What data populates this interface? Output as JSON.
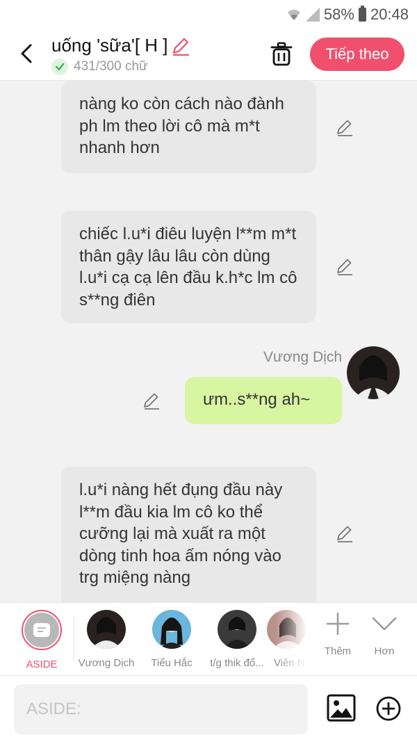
{
  "status": {
    "battery": "58%",
    "time": "20:48"
  },
  "header": {
    "title": "uống 'sữa'[ H ]",
    "word_count": "431/300 chữ",
    "next_label": "Tiếp theo"
  },
  "messages": [
    {
      "text": "nàng ko còn cách nào đành ph lm theo lời cô mà m*t nhanh hơn"
    },
    {
      "text": "chiếc l.u*i điêu luyện l**m m*t thân gậy lâu lâu còn dùng l.u*i cạ cạ lên đầu k.h*c lm cô s**ng điên"
    },
    {
      "speaker": "Vương Dịch",
      "text": "ưm..s**ng ah~"
    },
    {
      "text": "l.u*i nàng hết đụng đầu này l**m đầu kia lm cô ko thể cưỡng lại mà xuất ra một dòng tinh hoa ấm nóng vào trg miệng nàng"
    }
  ],
  "characters": [
    {
      "name": "ASIDE",
      "active": true
    },
    {
      "name": "Vương Dịch"
    },
    {
      "name": "Tiểu Hắc"
    },
    {
      "name": "t/g thik đổ..."
    },
    {
      "name": "Viên N"
    }
  ],
  "controls": {
    "add_label": "Thêm",
    "more_label": "Hơn"
  },
  "input": {
    "placeholder": "ASIDE:"
  },
  "colors": {
    "accent": "#f0506e",
    "green_bubble": "#d8f5a2",
    "gray_bubble": "#e8e8e8"
  }
}
